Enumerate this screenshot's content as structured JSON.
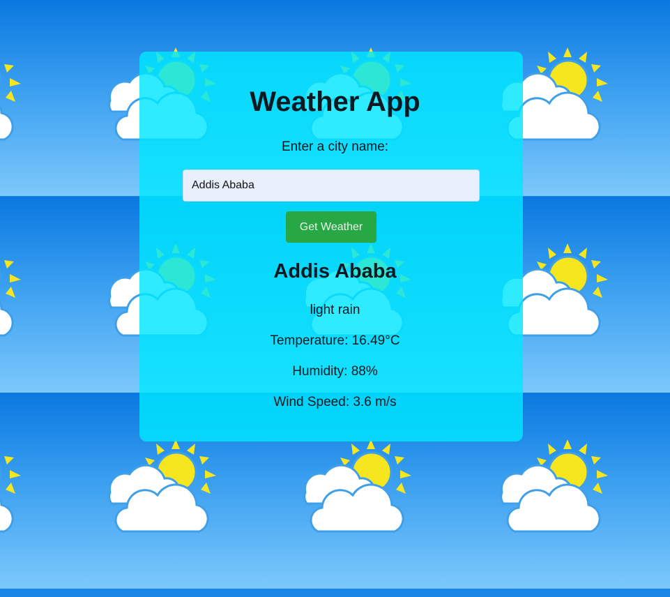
{
  "app": {
    "title": "Weather App",
    "prompt_label": "Enter a city name:"
  },
  "search": {
    "value": "Addis Ababa",
    "button_label": "Get Weather"
  },
  "result": {
    "city": "Addis Ababa",
    "description": "light rain",
    "temperature_label": "Temperature: 16.49°C",
    "humidity_label": "Humidity: 88%",
    "wind_label": "Wind Speed: 3.6 m/s"
  },
  "background": {
    "icon": "sun-behind-clouds-icon",
    "colors": {
      "sky_top": "#0a78e0",
      "sky_bottom": "#7cc8fb",
      "sun": "#f5e620",
      "cloud": "#ffffff",
      "cloud_outline": "#3f9fe8"
    }
  },
  "colors": {
    "card": "#00e7ff",
    "button": "#28a745",
    "input_bg": "#e8f0fe"
  }
}
